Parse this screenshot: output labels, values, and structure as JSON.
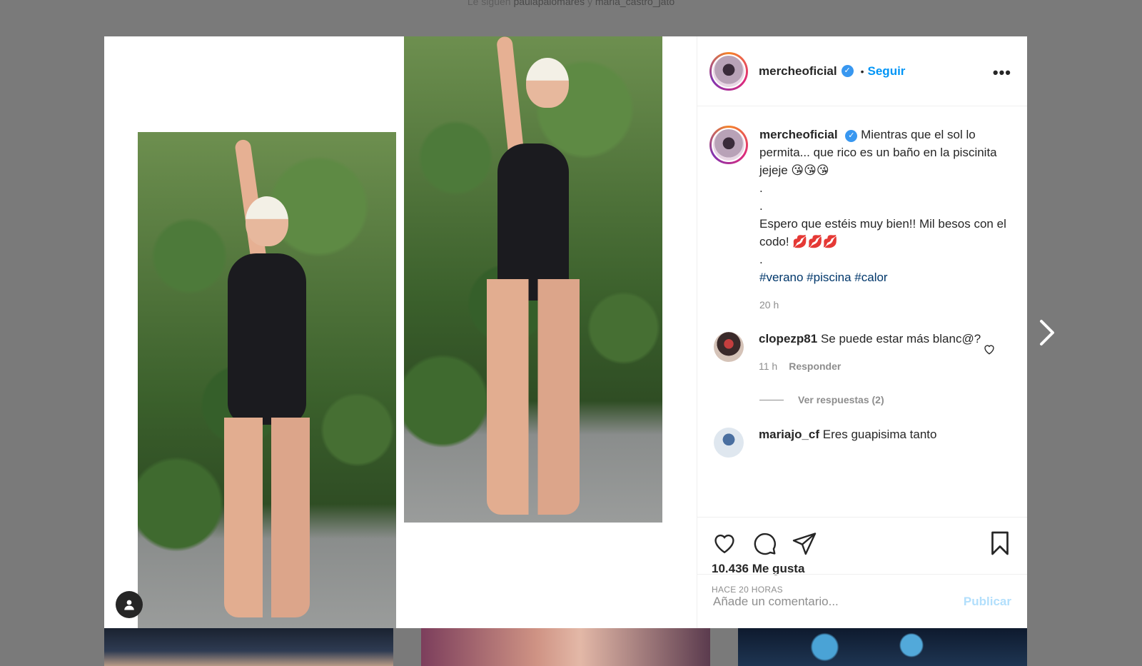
{
  "top_banner": {
    "prefix": "Le siguen",
    "user1": "paulapalomares",
    "joiner": "y",
    "user2": "maria_castro_jato"
  },
  "post": {
    "username": "mercheoficial",
    "follow_separator": "•",
    "follow_label": "Seguir",
    "more_label": "•••",
    "caption": {
      "line1": "Mientras que el sol lo permita... que rico es un baño en la piscinita jejeje 😘😘😘",
      "dot1": ".",
      "dot2": ".",
      "line2": "Espero que estéis muy bien!! Mil besos con el codo! 💋💋💋",
      "dot3": ".",
      "hashtags": [
        "#verano",
        "#piscina",
        "#calor"
      ],
      "time": "20 h"
    },
    "comments": [
      {
        "user": "clopezp81",
        "text": "Se puede estar más blanc@?",
        "time": "11 h",
        "reply_label": "Responder",
        "view_replies": "Ver respuestas (2)"
      },
      {
        "user": "mariajo_cf",
        "text": "Eres guapisima tanto"
      }
    ],
    "likes": "10.436 Me gusta",
    "date_ago": "HACE 20 HORAS",
    "comment_placeholder": "Añade un comentario...",
    "publish_label": "Publicar"
  },
  "icons": [
    "heart-icon",
    "comment-icon",
    "share-icon",
    "bookmark-icon",
    "chevron-right-icon",
    "user-icon",
    "verified-icon"
  ],
  "colors": {
    "link": "#0095f6",
    "hashtag": "#00376b",
    "muted": "#8e8e8e",
    "publish_disabled": "#b2dffc"
  }
}
